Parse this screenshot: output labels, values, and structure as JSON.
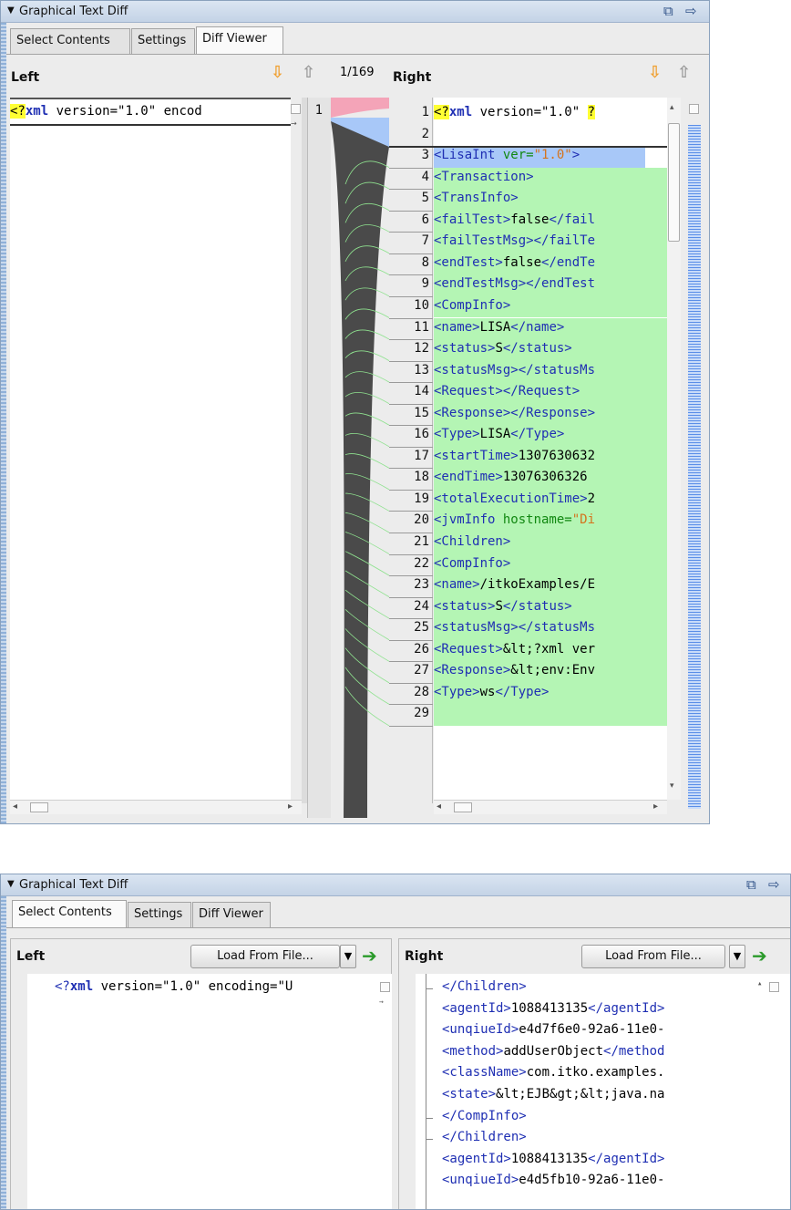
{
  "panel_title": "Graphical Text Diff",
  "top": {
    "tabs": [
      "Select Contents",
      "Settings",
      "Diff Viewer"
    ],
    "active_tab": "Diff Viewer",
    "left_label": "Left",
    "right_label": "Right",
    "diff_counter": "1/169",
    "left_line_number": "1",
    "left_text": {
      "hl": "<?",
      "kw": "xml",
      "rest": " version=\"1.0\" encod"
    },
    "right_lines": [
      {
        "n": "1",
        "parts": [
          [
            "hl",
            "<?"
          ],
          [
            "kw",
            "xml"
          ],
          [
            "plain",
            " version=\"1.0\" "
          ],
          [
            "hl",
            "?"
          ]
        ],
        "bg": ""
      },
      {
        "n": "2",
        "parts": [],
        "bg": ""
      },
      {
        "n": "3",
        "parts": [
          [
            "tag",
            "<LisaInt "
          ],
          [
            "attr",
            "ver="
          ],
          [
            "str",
            "\"1.0\""
          ],
          [
            "tag",
            ">"
          ]
        ],
        "bg": "sel"
      },
      {
        "n": "4",
        "parts": [
          [
            "tag",
            "<Transaction>"
          ]
        ],
        "bg": "add"
      },
      {
        "n": "5",
        "parts": [
          [
            "tag",
            "<TransInfo>"
          ]
        ],
        "bg": "add"
      },
      {
        "n": "6",
        "parts": [
          [
            "tag",
            "<failTest>"
          ],
          [
            "plain",
            "false"
          ],
          [
            "tag",
            "</fail"
          ]
        ],
        "bg": "add"
      },
      {
        "n": "7",
        "parts": [
          [
            "tag",
            "<failTestMsg></failTe"
          ]
        ],
        "bg": "add"
      },
      {
        "n": "8",
        "parts": [
          [
            "tag",
            "<endTest>"
          ],
          [
            "plain",
            "false"
          ],
          [
            "tag",
            "</endTe"
          ]
        ],
        "bg": "add"
      },
      {
        "n": "9",
        "parts": [
          [
            "tag",
            "<endTestMsg></endTest"
          ]
        ],
        "bg": "add"
      },
      {
        "n": "10",
        "parts": [
          [
            "tag",
            "<CompInfo>"
          ]
        ],
        "bg": "add"
      },
      {
        "n": "11",
        "parts": [
          [
            "tag",
            "<name>"
          ],
          [
            "plain",
            "LISA"
          ],
          [
            "tag",
            "</name>"
          ]
        ],
        "bg": "add"
      },
      {
        "n": "12",
        "parts": [
          [
            "tag",
            "<status>"
          ],
          [
            "plain",
            "S"
          ],
          [
            "tag",
            "</status>"
          ]
        ],
        "bg": "add"
      },
      {
        "n": "13",
        "parts": [
          [
            "tag",
            "<statusMsg></statusMs"
          ]
        ],
        "bg": "add"
      },
      {
        "n": "14",
        "parts": [
          [
            "tag",
            "<Request></Request>"
          ]
        ],
        "bg": "add"
      },
      {
        "n": "15",
        "parts": [
          [
            "tag",
            "<Response></Response>"
          ]
        ],
        "bg": "add"
      },
      {
        "n": "16",
        "parts": [
          [
            "tag",
            "<Type>"
          ],
          [
            "plain",
            "LISA"
          ],
          [
            "tag",
            "</Type>"
          ]
        ],
        "bg": "add"
      },
      {
        "n": "17",
        "parts": [
          [
            "tag",
            "<startTime>"
          ],
          [
            "plain",
            "1307630632"
          ]
        ],
        "bg": "add"
      },
      {
        "n": "18",
        "parts": [
          [
            "tag",
            "<endTime>"
          ],
          [
            "plain",
            "13076306326"
          ]
        ],
        "bg": "add"
      },
      {
        "n": "19",
        "parts": [
          [
            "tag",
            "<totalExecutionTime>"
          ],
          [
            "plain",
            "2"
          ]
        ],
        "bg": "add"
      },
      {
        "n": "20",
        "parts": [
          [
            "tag",
            "<jvmInfo "
          ],
          [
            "attr",
            "hostname="
          ],
          [
            "str",
            "\"Di"
          ]
        ],
        "bg": "add"
      },
      {
        "n": "21",
        "parts": [
          [
            "tag",
            "<Children>"
          ]
        ],
        "bg": "add"
      },
      {
        "n": "22",
        "parts": [
          [
            "tag",
            "<CompInfo>"
          ]
        ],
        "bg": "add"
      },
      {
        "n": "23",
        "parts": [
          [
            "tag",
            "<name>"
          ],
          [
            "plain",
            "/itkoExamples/E"
          ]
        ],
        "bg": "add"
      },
      {
        "n": "24",
        "parts": [
          [
            "tag",
            "<status>"
          ],
          [
            "plain",
            "S"
          ],
          [
            "tag",
            "</status>"
          ]
        ],
        "bg": "add"
      },
      {
        "n": "25",
        "parts": [
          [
            "tag",
            "<statusMsg></statusMs"
          ]
        ],
        "bg": "add"
      },
      {
        "n": "26",
        "parts": [
          [
            "tag",
            "<Request>"
          ],
          [
            "plain",
            "&lt;?xml ver"
          ]
        ],
        "bg": "add"
      },
      {
        "n": "27",
        "parts": [
          [
            "tag",
            "<Response>"
          ],
          [
            "plain",
            "&lt;env:Env"
          ]
        ],
        "bg": "add"
      },
      {
        "n": "28",
        "parts": [
          [
            "tag",
            "<Type>"
          ],
          [
            "plain",
            "ws"
          ],
          [
            "tag",
            "</Type>"
          ]
        ],
        "bg": "add"
      },
      {
        "n": "29",
        "parts": [],
        "bg": "add"
      }
    ]
  },
  "bottom": {
    "tabs": [
      "Select Contents",
      "Settings",
      "Diff Viewer"
    ],
    "active_tab": "Select Contents",
    "left_label": "Left",
    "right_label": "Right",
    "load_button": "Load From File...",
    "left_text": {
      "pre": "<?",
      "kw": "xml",
      "rest": " version=\"1.0\" encoding=\"U"
    },
    "right_lines": [
      [
        [
          "tag",
          "</Children>"
        ]
      ],
      [
        [
          "tag",
          "<agentId>"
        ],
        [
          "plain",
          "1088413135"
        ],
        [
          "tag",
          "</agentId>"
        ]
      ],
      [
        [
          "tag",
          "<unqiueId>"
        ],
        [
          "plain",
          "e4d7f6e0-92a6-11e0-"
        ]
      ],
      [
        [
          "tag",
          "<method>"
        ],
        [
          "plain",
          "addUserObject"
        ],
        [
          "tag",
          "</method"
        ]
      ],
      [
        [
          "tag",
          "<className>"
        ],
        [
          "plain",
          "com.itko.examples."
        ]
      ],
      [
        [
          "tag",
          "<state>"
        ],
        [
          "plain",
          "&lt;EJB&gt;&lt;java.na"
        ]
      ],
      [
        [
          "tag",
          "</CompInfo>"
        ]
      ],
      [
        [
          "tag",
          "</Children>"
        ]
      ],
      [
        [
          "tag",
          "<agentId>"
        ],
        [
          "plain",
          "1088413135"
        ],
        [
          "tag",
          "</agentId>"
        ]
      ],
      [
        [
          "tag",
          "<unqiueId>"
        ],
        [
          "plain",
          "e4d5fb10-92a6-11e0-"
        ]
      ]
    ]
  },
  "colors": {
    "added": "#b4f5b4",
    "selected": "#a8c8f8",
    "deleted": "#f4a4b8",
    "accent": "#8aa1bd"
  }
}
